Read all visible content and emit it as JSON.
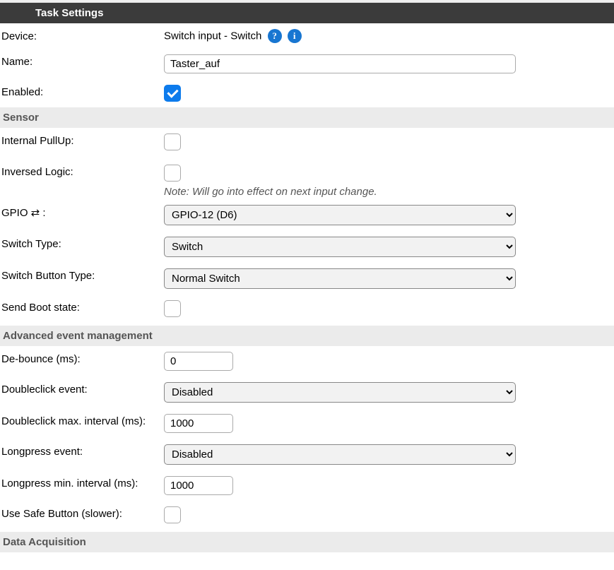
{
  "header": {
    "title": "Task Settings"
  },
  "general": {
    "device_label": "Device:",
    "device_value": "Switch input - Switch",
    "help_symbol": "?",
    "info_symbol": "i",
    "name_label": "Name:",
    "name_value": "Taster_auf",
    "enabled_label": "Enabled:",
    "enabled_checked": true
  },
  "sensor": {
    "title": "Sensor",
    "internal_pullup_label": "Internal PullUp:",
    "inversed_logic_label": "Inversed Logic:",
    "inversed_note": "Note: Will go into effect on next input change.",
    "gpio_label": "GPIO ⇄ :",
    "gpio_value": "GPIO-12 (D6)",
    "switch_type_label": "Switch Type:",
    "switch_type_value": "Switch",
    "switch_button_type_label": "Switch Button Type:",
    "switch_button_type_value": "Normal Switch",
    "send_boot_label": "Send Boot state:"
  },
  "advanced": {
    "title": "Advanced event management",
    "debounce_label": "De-bounce (ms):",
    "debounce_value": "0",
    "doubleclick_event_label": "Doubleclick event:",
    "doubleclick_event_value": "Disabled",
    "doubleclick_max_label": "Doubleclick max. interval (ms):",
    "doubleclick_max_value": "1000",
    "longpress_event_label": "Longpress event:",
    "longpress_event_value": "Disabled",
    "longpress_min_label": "Longpress min. interval (ms):",
    "longpress_min_value": "1000",
    "use_safe_label": "Use Safe Button (slower):"
  },
  "data_acq": {
    "title": "Data Acquisition"
  }
}
